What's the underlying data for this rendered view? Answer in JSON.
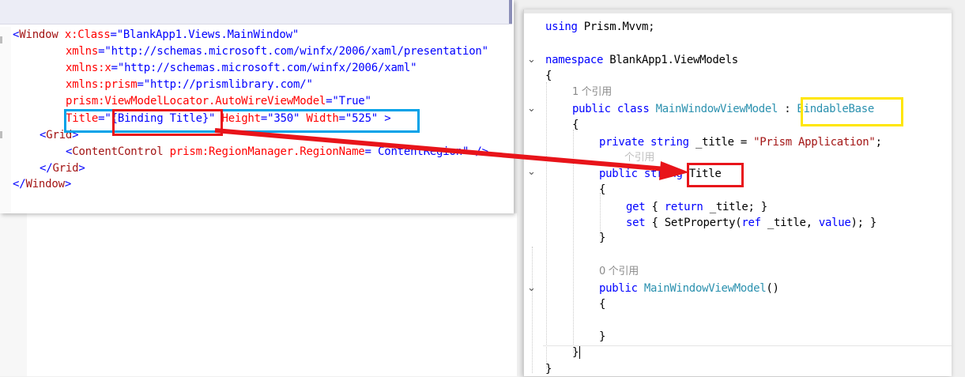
{
  "xaml": {
    "lines": {
      "l1": {
        "lt": "<",
        "tag": "Window",
        "attr": " x:Class",
        "eq": "=",
        "val": "\"BlankApp1.Views.MainWindow\""
      },
      "l2": {
        "attr": "xmlns",
        "eq": "=",
        "val": "\"http://schemas.microsoft.com/winfx/2006/xaml/presentation\""
      },
      "l3": {
        "attr": "xmlns:x",
        "eq": "=",
        "val": "\"http://schemas.microsoft.com/winfx/2006/xaml\""
      },
      "l4": {
        "attr": "xmlns:prism",
        "eq": "=",
        "val": "\"http://prismlibrary.com/\""
      },
      "l5": {
        "attr": "prism:ViewModelLocator.AutoWireViewModel",
        "eq": "=",
        "val": "\"True\""
      },
      "l6": {
        "a1": "Title",
        "eq1": "=",
        "v1": "\"{Binding Title}\"",
        "a2": " Height",
        "eq2": "=",
        "v2": "\"350\"",
        "a3": " Width",
        "eq3": "=",
        "v3": "\"525\"",
        "gt": " >"
      },
      "l7": {
        "lt": "<",
        "tag": "Grid",
        "gt": ">"
      },
      "l8": {
        "lt": "<",
        "tag": "ContentControl",
        "attr": " prism:RegionManager.RegionName",
        "eq": "=",
        "val": " ContentRegion\"",
        "end": " />"
      },
      "l9": {
        "lt": "</",
        "tag": "Grid",
        "gt": ">"
      },
      "l10": {
        "lt": "</",
        "tag": "Window",
        "gt": ">"
      }
    }
  },
  "cs": {
    "using": {
      "kw": "using",
      "rest": " Prism.Mvvm;"
    },
    "namespace": {
      "kw": "namespace",
      "rest": " BlankApp1.ViewModels"
    },
    "brace_open": "{",
    "brace_close": "}",
    "ref1": "1 个引用",
    "class_line": {
      "kw": "public class",
      "name": " MainWindowViewModel",
      "colon": " : ",
      "base": "BindableBase"
    },
    "field": {
      "kw": "private string",
      "rest": " _title = ",
      "str": "\"Prism Application\"",
      "end": ";"
    },
    "ref_hidden": "个引用",
    "prop": {
      "kw": "public string",
      "name": " Title"
    },
    "get_line": {
      "kw1": "get",
      "p1": " { ",
      "kw2": "return",
      "p2": " _title; }"
    },
    "set_line": {
      "kw1": "set",
      "p1": " { SetProperty(",
      "kw2": "ref",
      "p2": " _title, ",
      "kw3": "value",
      "p3": "); }"
    },
    "ref0": "0 个引用",
    "ctor": {
      "kw": "public",
      "name": " MainWindowViewModel",
      "rest": "()"
    }
  },
  "colors": {
    "highlight_blue": "#00a2e8",
    "highlight_red": "#e8141a",
    "highlight_yellow": "#ffe600",
    "arrow_red": "#e8141a"
  }
}
